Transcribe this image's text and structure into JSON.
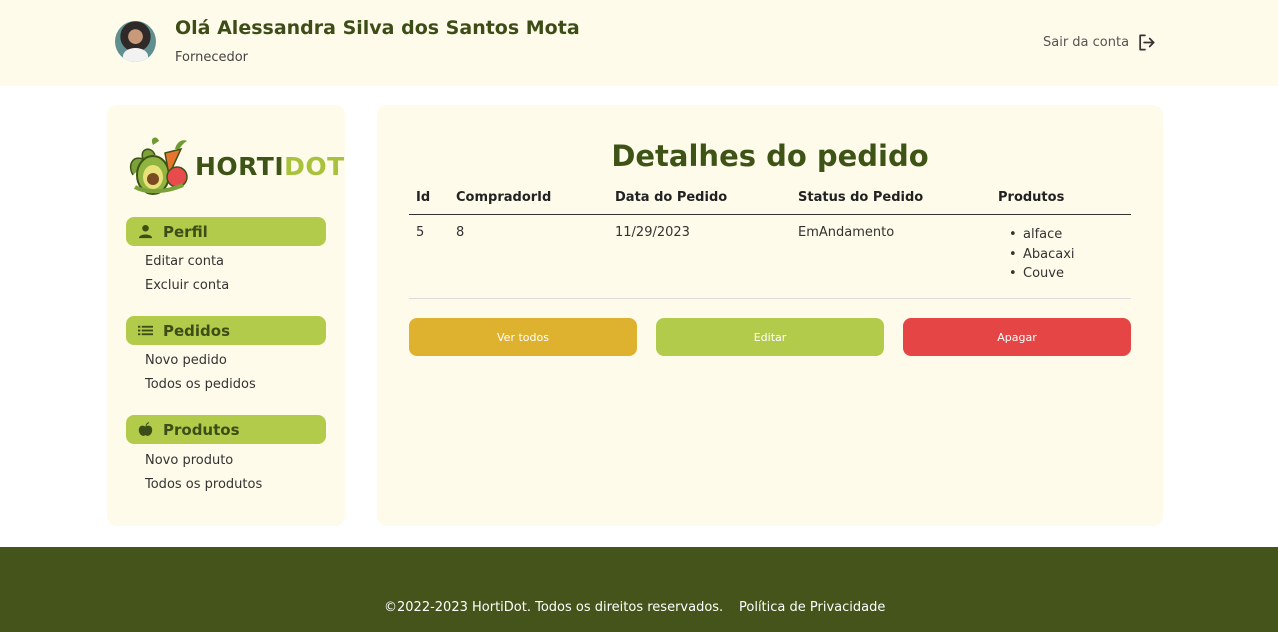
{
  "header": {
    "greeting": "Olá Alessandra Silva dos Santos Mota",
    "role": "Fornecedor",
    "logout_label": "Sair da conta",
    "logout_icon": "logout-icon"
  },
  "sidebar": {
    "logo": {
      "part1": "HORTI",
      "part2": "DOT"
    },
    "sections": [
      {
        "label": "Perfil",
        "icon": "user-icon",
        "items": [
          "Editar conta",
          "Excluir conta"
        ]
      },
      {
        "label": "Pedidos",
        "icon": "list-icon",
        "items": [
          "Novo pedido",
          "Todos os pedidos"
        ]
      },
      {
        "label": "Produtos",
        "icon": "apple-icon",
        "items": [
          "Novo produto",
          "Todos os produtos"
        ]
      }
    ]
  },
  "main": {
    "title": "Detalhes do pedido",
    "columns": [
      "Id",
      "CompradorId",
      "Data do Pedido",
      "Status do Pedido",
      "Produtos"
    ],
    "row": {
      "id": "5",
      "comprador_id": "8",
      "data": "11/29/2023",
      "status": "EmAndamento",
      "produtos": [
        "alface",
        "Abacaxi",
        "Couve"
      ]
    },
    "buttons": {
      "ver_todos": "Ver todos",
      "editar": "Editar",
      "apagar": "Apagar"
    }
  },
  "footer": {
    "copyright": "©2022-2023 HortiDot. Todos os direitos reservados.",
    "privacy": "Política de Privacidade"
  },
  "colors": {
    "header_bg": "#fefbea",
    "accent_green": "#b3cb4a",
    "dark_green": "#3e5316",
    "footer_bg": "#45541a",
    "btn_yellow": "#deb12e",
    "btn_green": "#b3cb4a",
    "btn_red": "#e64545"
  }
}
